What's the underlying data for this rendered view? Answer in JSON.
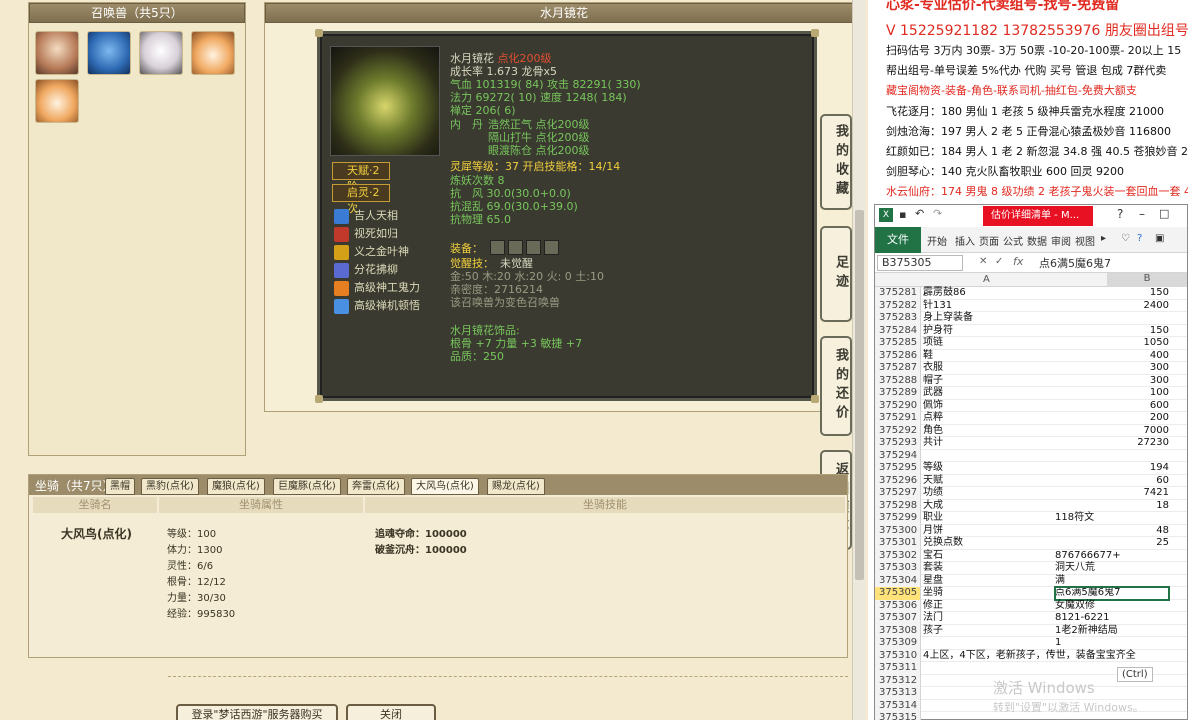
{
  "pets_panel": {
    "title": "召唤兽（共5只）",
    "thumbs": [
      "#e8c9a8",
      "#3d7fc1",
      "#e8e2e0",
      "#e7a05c",
      "#e8a868"
    ]
  },
  "detail": {
    "header": "水月镜花",
    "name": "水月镜花",
    "name_tag": "点化200级",
    "growth": "成长率 1.673 龙骨x5",
    "hp_line": "气血 101319( 84) 攻击 82291( 330)",
    "mp_line": "法力 69272( 10) 速度 1248( 184)",
    "zen_line": "禅定 206( 6)",
    "neidan_label": "内　丹",
    "neidan_1": "浩然正气 点化200级",
    "neidan_2": "隔山打牛 点化200级",
    "neidan_3": "眼渡陈仓 点化200级",
    "spirit_line": "灵犀等级：37 开启技能格：14/14",
    "refine_line": "炼妖次数 8",
    "resist_wind": "抗　风 30.0(30.0+0.0)",
    "resist_chaos": "抗混乱 69.0(30.0+39.0)",
    "resist_phys": "抗物理 65.0",
    "equip_label": "装备：",
    "awaken_label": "觉醒技：",
    "awaken_value": "未觉醒",
    "elements": "金:50 木:20 水:20 火: 0 土:10",
    "intimacy": "亲密度：2716214",
    "variant": "该召唤兽为变色召唤兽",
    "ornament_title": "水月镜花饰品:",
    "ornament_stats": "根骨 +7 力量 +3 敏捷 +7",
    "quality": "品质：250",
    "badge1": "天赋·2阶",
    "badge2": "启灵·2次",
    "skills": [
      {
        "name": "吉人天相",
        "color": "#3a7bd5"
      },
      {
        "name": "视死如归",
        "color": "#c0392b"
      },
      {
        "name": "义之金叶神",
        "color": "#d4a017"
      },
      {
        "name": "分花拂柳",
        "color": "#5b6ad0"
      },
      {
        "name": "高级神工鬼力",
        "color": "#e67e22"
      },
      {
        "name": "高级禅机顿悟",
        "color": "#4a90e2"
      }
    ]
  },
  "side_tabs": [
    "我的收藏",
    "足迹",
    "我的还价",
    "返回顶部"
  ],
  "mount": {
    "title": "坐骑（共7只）",
    "tabs": [
      "黑帽",
      "黑豹(点化)",
      "魔狼(点化)",
      "巨魔豚(点化)",
      "奔雷(点化)",
      "大风鸟(点化)",
      "赐龙(点化)"
    ],
    "col_name": "坐骑名",
    "col_attr": "坐骑属性",
    "col_skill": "坐骑技能",
    "name": "大风鸟(点化)",
    "attrs": [
      "等级：100",
      "体力：1300",
      "灵性：6/6",
      "根骨：12/12",
      "力量：30/30",
      "经验：995830"
    ],
    "skills": [
      "追魂夺命：100000",
      "破釜沉舟：100000"
    ]
  },
  "bottom_buttons": [
    "登录\"梦话西游\"服务器购买",
    "关闭"
  ],
  "ads": {
    "line0": "心浆-专业估价-代卖组号-找号-免费留",
    "line1": "V 15225921182  13782553976 朋友圈出组号",
    "line2": "扫码估号 3万内 30票- 3万 50票  -10-20-100票- 20以上 15",
    "line3": "帮出组号-单号误差 5%代办 代购 买号 管退 包成 7群代卖",
    "line4": "藏宝阁物资-装备-角色-联系司机-抽红包-免费大额支",
    "line5": "飞花逐月：180 男仙 1 老孩 5 级神兵雷克水程度 21000",
    "line6": "剑烛沧海：197 男人 2 老 5 正骨混心猿孟极妙音 116800",
    "line7": "红颜如已：184 男人 1 老 2 新忽混 34.8 强 40.5 苍狼妙音 229",
    "line8": "剑胆琴心：140 克火队畜牧职业 600 回灵 9200",
    "line9": "水云仙府：174 男鬼 8 级功绩 2 老孩子鬼火装一套回血一套 4"
  },
  "excel": {
    "title_tab": "估价详细清单 - M...",
    "file_tab": "文件",
    "ribbon_tabs": [
      "开始",
      "插入",
      "页面",
      "公式",
      "数据",
      "审阅",
      "视图"
    ],
    "namebox": "B375305",
    "formula": "点6满5魔6鬼7",
    "col_a": "A",
    "col_b": "B",
    "rows": [
      {
        "n": "375281",
        "a": "霹雳鼓86",
        "b": "150",
        "num": true
      },
      {
        "n": "375282",
        "a": "针131",
        "b": "2400",
        "num": true
      },
      {
        "n": "375283",
        "a": "身上穿装备",
        "b": "",
        "num": true
      },
      {
        "n": "375284",
        "a": "护身符",
        "b": "150",
        "num": true
      },
      {
        "n": "375285",
        "a": "项链",
        "b": "1050",
        "num": true
      },
      {
        "n": "375286",
        "a": "鞋",
        "b": "400",
        "num": true
      },
      {
        "n": "375287",
        "a": "衣服",
        "b": "300",
        "num": true
      },
      {
        "n": "375288",
        "a": "帽子",
        "b": "300",
        "num": true
      },
      {
        "n": "375289",
        "a": "武器",
        "b": "100",
        "num": true
      },
      {
        "n": "375290",
        "a": "佩饰",
        "b": "600",
        "num": true
      },
      {
        "n": "375291",
        "a": "点粹",
        "b": "200",
        "num": true
      },
      {
        "n": "375292",
        "a": "角色",
        "b": "7000",
        "num": true
      },
      {
        "n": "375293",
        "a": "共计",
        "b": "27230",
        "num": true
      },
      {
        "n": "375294",
        "a": "",
        "b": "",
        "num": true
      },
      {
        "n": "375295",
        "a": "等级",
        "b": "194",
        "num": true
      },
      {
        "n": "375296",
        "a": "天赋",
        "b": "60",
        "num": true
      },
      {
        "n": "375297",
        "a": "功绩",
        "b": "7421",
        "num": true
      },
      {
        "n": "375298",
        "a": "大成",
        "b": "18",
        "num": true
      },
      {
        "n": "375299",
        "a": "职业",
        "b": "118符文",
        "num": false
      },
      {
        "n": "375300",
        "a": "月饼",
        "b": "48",
        "num": true
      },
      {
        "n": "375301",
        "a": "兑换点数",
        "b": "25",
        "num": true
      },
      {
        "n": "375302",
        "a": "宝石",
        "b": "876766677+",
        "num": false
      },
      {
        "n": "375303",
        "a": "套装",
        "b": "洞天八荒",
        "num": false
      },
      {
        "n": "375304",
        "a": "星盘",
        "b": "满",
        "num": false
      },
      {
        "n": "375305",
        "a": "坐骑",
        "b": "点6满5魔6鬼7",
        "num": false,
        "sel": true
      },
      {
        "n": "375306",
        "a": "修正",
        "b": "女魔双修",
        "num": false
      },
      {
        "n": "375307",
        "a": "法门",
        "b": "8121-6221",
        "num": false
      },
      {
        "n": "375308",
        "a": "孩子",
        "b": "1老2新神结局",
        "num": false
      },
      {
        "n": "375309",
        "a": "",
        "b": "1",
        "num": false
      },
      {
        "n": "375310",
        "a": "4上区，4下区，老新孩子，传世，装备宝宝齐全",
        "b": "",
        "num": false
      },
      {
        "n": "375311",
        "a": "",
        "b": "",
        "num": false
      },
      {
        "n": "375312",
        "a": "",
        "b": "",
        "num": false
      },
      {
        "n": "375313",
        "a": "",
        "b": "",
        "num": false
      },
      {
        "n": "375314",
        "a": "",
        "b": "",
        "num": false
      },
      {
        "n": "375315",
        "a": "",
        "b": "",
        "num": false
      }
    ],
    "ctrl_tag": "(Ctrl)",
    "watermark": "激活 Windows",
    "watermark_sub": "转到\"设置\"以激活 Windows。"
  }
}
